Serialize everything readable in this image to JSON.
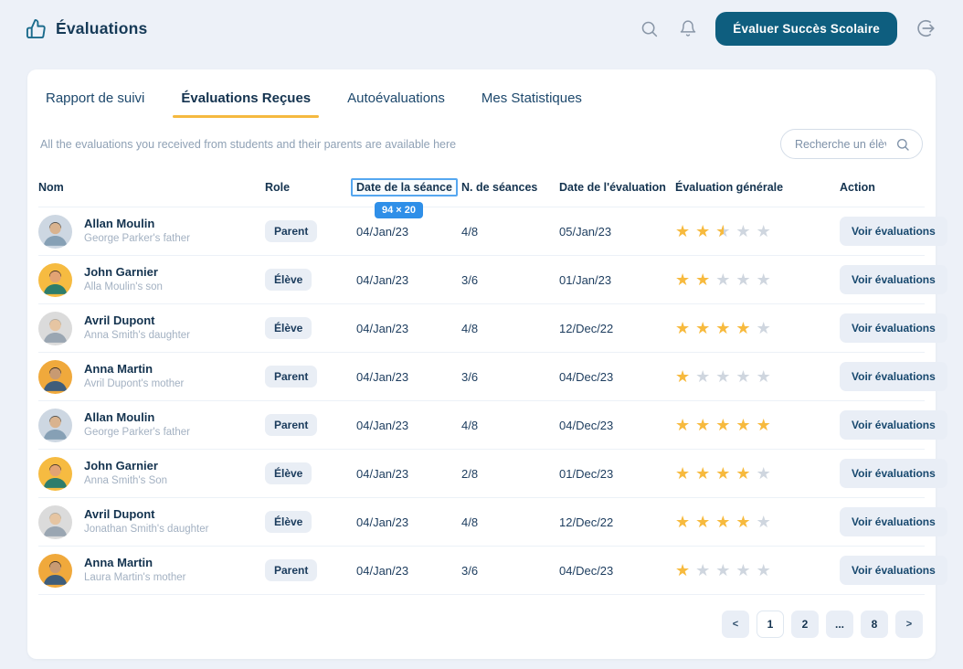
{
  "colors": {
    "primary_teal": "#0E5E7F",
    "accent_yellow": "#F5B93F",
    "star_gold": "#F7BA3E",
    "star_gray": "#CFD6DF",
    "inspector_blue": "#2F8FE8"
  },
  "header": {
    "title": "Évaluations",
    "evaluate_button": "Évaluer Succès Scolaire"
  },
  "tabs": [
    {
      "label": "Rapport de suivi",
      "active": false
    },
    {
      "label": "Évaluations Reçues",
      "active": true
    },
    {
      "label": "Autoévaluations",
      "active": false
    },
    {
      "label": "Mes Statistiques",
      "active": false
    }
  ],
  "description": "All the evaluations you received from students and their parents are available here",
  "search": {
    "placeholder": "Recherche un élève"
  },
  "table": {
    "columns": [
      "Nom",
      "Role",
      "Date de la séance",
      "N. de séances",
      "Date de l'évaluation",
      "Évaluation générale",
      "Action"
    ],
    "inspected_column": {
      "index": 2,
      "size_label": "94 × 20"
    },
    "action_label": "Voir évaluations",
    "rows": [
      {
        "name": "Allan Moulin",
        "relation": "George Parker's father",
        "role": "Parent",
        "session_date": "04/Jan/23",
        "sessions": "4/8",
        "eval_date": "05/Jan/23",
        "rating": 2.5,
        "avatar": "man-glasses"
      },
      {
        "name": "John Garnier",
        "relation": "Alla Moulin's son",
        "role": "Élève",
        "session_date": "04/Jan/23",
        "sessions": "3/6",
        "eval_date": "01/Jan/23",
        "rating": 2,
        "avatar": "boy"
      },
      {
        "name": "Avril Dupont",
        "relation": "Anna Smith's daughter",
        "role": "Élève",
        "session_date": "04/Jan/23",
        "sessions": "4/8",
        "eval_date": "12/Dec/22",
        "rating": 4,
        "avatar": "woman-blonde"
      },
      {
        "name": "Anna Martin",
        "relation": "Avril Dupont's mother",
        "role": "Parent",
        "session_date": "04/Jan/23",
        "sessions": "3/6",
        "eval_date": "04/Dec/23",
        "rating": 1,
        "avatar": "woman-dark"
      },
      {
        "name": "Allan Moulin",
        "relation": "George Parker's father",
        "role": "Parent",
        "session_date": "04/Jan/23",
        "sessions": "4/8",
        "eval_date": "04/Dec/23",
        "rating": 5,
        "avatar": "man-glasses"
      },
      {
        "name": "John Garnier",
        "relation": "Anna Smith's Son",
        "role": "Élève",
        "session_date": "04/Jan/23",
        "sessions": "2/8",
        "eval_date": "01/Dec/23",
        "rating": 4,
        "avatar": "boy"
      },
      {
        "name": "Avril Dupont",
        "relation": "Jonathan Smith's daughter",
        "role": "Élève",
        "session_date": "04/Jan/23",
        "sessions": "4/8",
        "eval_date": "12/Dec/22",
        "rating": 4,
        "avatar": "woman-blonde"
      },
      {
        "name": "Anna Martin",
        "relation": "Laura Martin's mother",
        "role": "Parent",
        "session_date": "04/Jan/23",
        "sessions": "3/6",
        "eval_date": "04/Dec/23",
        "rating": 1,
        "avatar": "woman-dark"
      }
    ]
  },
  "pagination": {
    "items": [
      {
        "label": "<",
        "kind": "prev"
      },
      {
        "label": "1",
        "kind": "page",
        "active": true
      },
      {
        "label": "2",
        "kind": "page"
      },
      {
        "label": "...",
        "kind": "ellipsis"
      },
      {
        "label": "8",
        "kind": "page"
      },
      {
        "label": ">",
        "kind": "next"
      }
    ]
  }
}
